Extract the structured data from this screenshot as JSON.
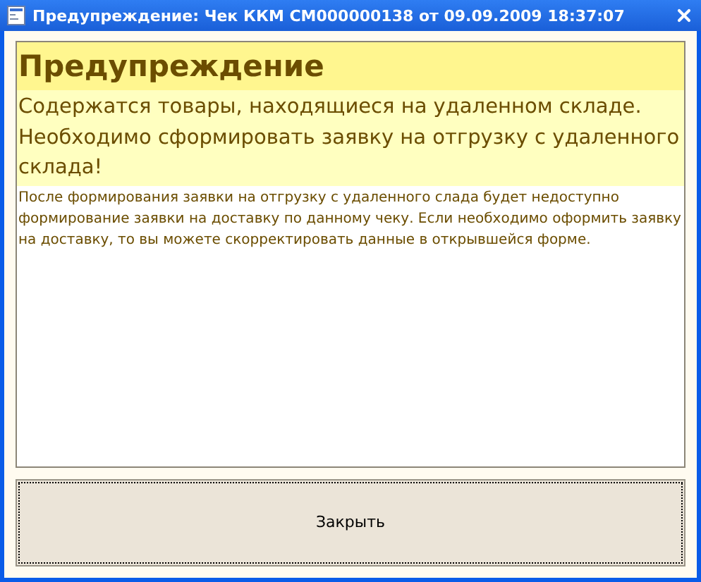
{
  "window": {
    "title": "Предупреждение: Чек ККМ СМ000000138 от 09.09.2009 18:37:07"
  },
  "message": {
    "heading": "Предупреждение",
    "lines": [
      "Содержатся товары, находящиеся на удаленном складе.",
      "Необходимо сформировать заявку на отгрузку с удаленного склада!"
    ],
    "note": "После формирования заявки на отгрузку с удаленного слада будет недоступно формирование заявки на доставку по данному чеку. Если необходимо оформить заявку на доставку, то вы можете скорректировать данные в открывшейся форме."
  },
  "buttons": [
    {
      "label": "Закрыть",
      "focused": true
    }
  ]
}
